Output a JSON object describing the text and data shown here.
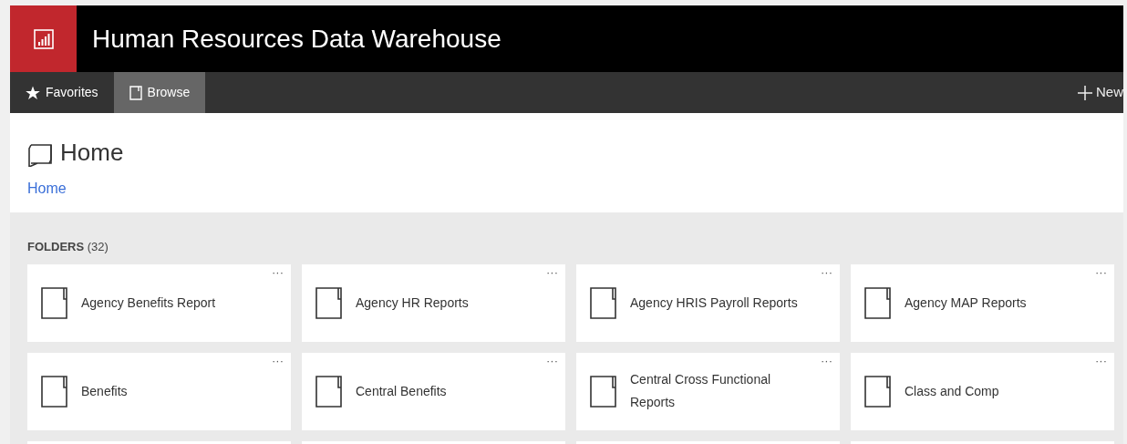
{
  "header": {
    "title": "Human Resources Data Warehouse"
  },
  "nav": {
    "tabs": [
      {
        "label": "Favorites",
        "kind": "favorites",
        "selected": false
      },
      {
        "label": "Browse",
        "kind": "browse",
        "selected": true
      }
    ],
    "new_button": "New"
  },
  "page": {
    "title": "Home",
    "breadcrumb": "Home"
  },
  "folders": {
    "heading": "FOLDERS",
    "count": "(32)",
    "items": [
      {
        "name": "Agency Benefits Report",
        "more": "···"
      },
      {
        "name": "Agency HR Reports",
        "more": "···"
      },
      {
        "name": "Agency HRIS Payroll Reports",
        "more": "···"
      },
      {
        "name": "Agency MAP Reports",
        "more": "···"
      },
      {
        "name": "Benefits",
        "more": "···"
      },
      {
        "name": "Central Benefits",
        "more": "···"
      },
      {
        "name": "Central Cross Functional Reports",
        "more": "···"
      },
      {
        "name": "Class and Comp",
        "more": "···"
      }
    ]
  }
}
